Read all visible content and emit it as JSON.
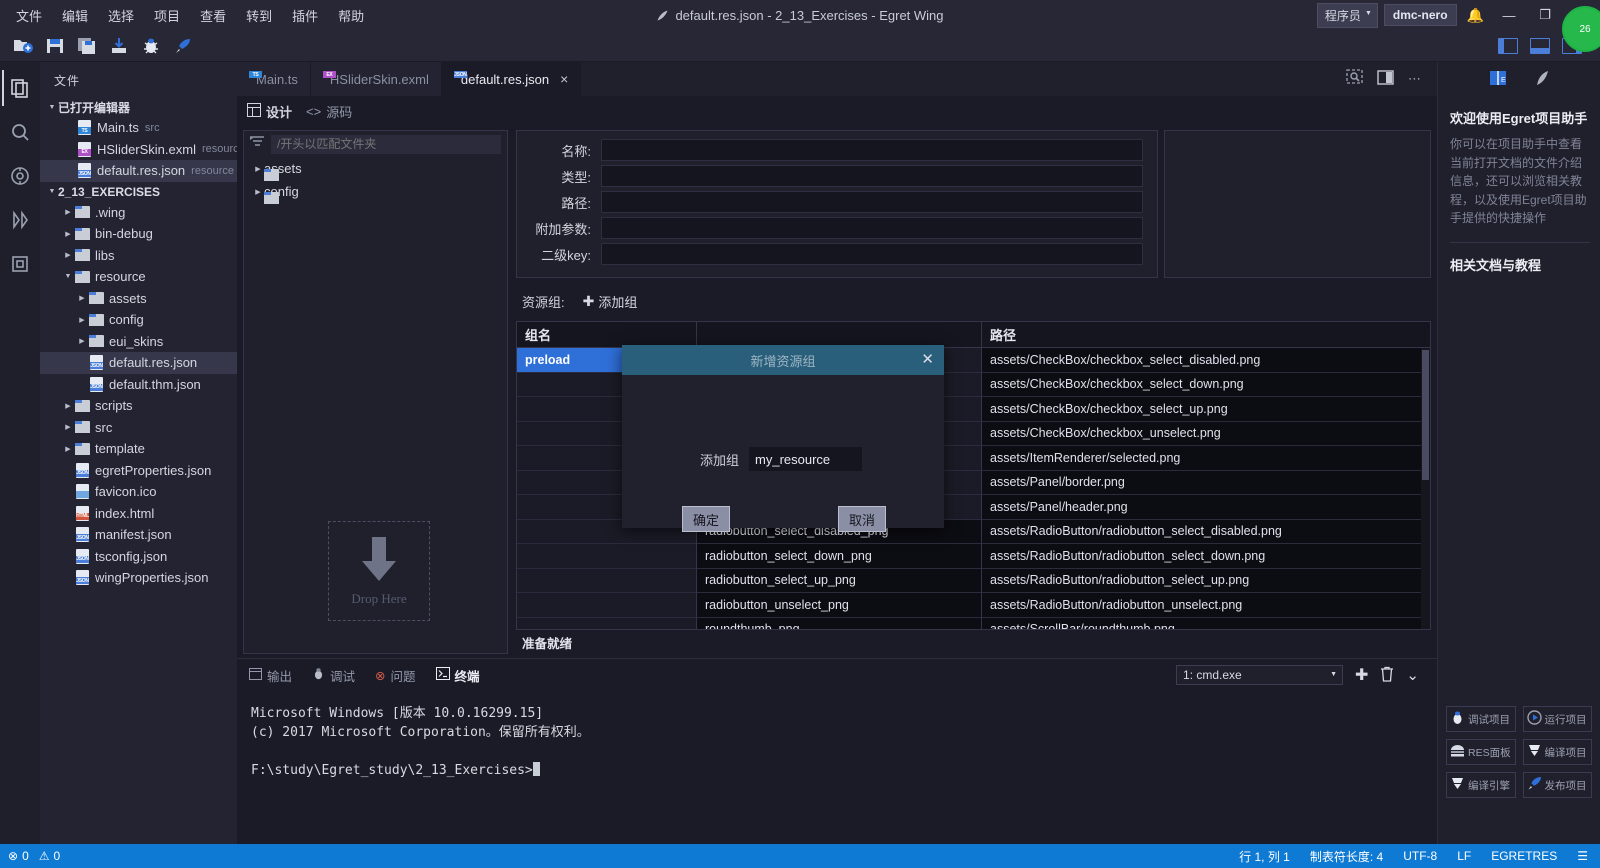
{
  "titlebar": {
    "menu": [
      "文件",
      "编辑",
      "选择",
      "项目",
      "查看",
      "转到",
      "插件",
      "帮助"
    ],
    "window_title": "default.res.json - 2_13_Exercises - Egret Wing",
    "role": "程序员",
    "user": "dmc-nero",
    "badge": "26"
  },
  "toolbar": {
    "icons": [
      "new-folder-icon",
      "save-icon",
      "save-all-icon",
      "import-icon",
      "debug-icon",
      "publish-icon"
    ],
    "layout_icons": [
      "layout-sidebar-icon",
      "layout-panel-icon",
      "layout-right-icon"
    ]
  },
  "activity": {
    "items": [
      "explorer-icon",
      "search-icon",
      "source-control-icon",
      "debug-icon",
      "extensions-icon"
    ]
  },
  "explorer": {
    "title": "文件",
    "open_editors_label": "已打开编辑器",
    "open_editors": [
      {
        "name": "Main.ts",
        "sub": "src",
        "icon": "ts-file-icon"
      },
      {
        "name": "HSliderSkin.exml",
        "sub": "resource\\eui_s...",
        "icon": "exml-file-icon"
      },
      {
        "name": "default.res.json",
        "sub": "resource",
        "icon": "json-file-icon"
      }
    ],
    "project_label": "2_13_EXERCISES",
    "tree": [
      {
        "name": ".wing",
        "type": "folder",
        "depth": 1,
        "open": false
      },
      {
        "name": "bin-debug",
        "type": "folder",
        "depth": 1,
        "open": false
      },
      {
        "name": "libs",
        "type": "folder",
        "depth": 1,
        "open": false
      },
      {
        "name": "resource",
        "type": "folder",
        "depth": 1,
        "open": true
      },
      {
        "name": "assets",
        "type": "folder",
        "depth": 2,
        "open": false
      },
      {
        "name": "config",
        "type": "folder",
        "depth": 2,
        "open": false
      },
      {
        "name": "eui_skins",
        "type": "folder",
        "depth": 2,
        "open": false
      },
      {
        "name": "default.res.json",
        "type": "json",
        "depth": 2,
        "selected": true
      },
      {
        "name": "default.thm.json",
        "type": "json",
        "depth": 2
      },
      {
        "name": "scripts",
        "type": "folder",
        "depth": 1,
        "open": false
      },
      {
        "name": "src",
        "type": "folder",
        "depth": 1,
        "open": false
      },
      {
        "name": "template",
        "type": "folder",
        "depth": 1,
        "open": false
      },
      {
        "name": "egretProperties.json",
        "type": "json",
        "depth": 1
      },
      {
        "name": "favicon.ico",
        "type": "ico",
        "depth": 1
      },
      {
        "name": "index.html",
        "type": "html",
        "depth": 1
      },
      {
        "name": "manifest.json",
        "type": "json",
        "depth": 1
      },
      {
        "name": "tsconfig.json",
        "type": "json",
        "depth": 1
      },
      {
        "name": "wingProperties.json",
        "type": "json",
        "depth": 1
      }
    ]
  },
  "editor": {
    "tabs": [
      {
        "label": "Main.ts",
        "icon": "ts-file-icon",
        "active": false
      },
      {
        "label": "HSliderSkin.exml",
        "icon": "exml-file-icon",
        "active": false
      },
      {
        "label": "default.res.json",
        "icon": "json-file-icon",
        "active": true,
        "close": "×"
      }
    ],
    "tab_tools": [
      "preview-icon",
      "split-editor-icon",
      "more-actions-icon"
    ],
    "subtabs": [
      {
        "label": "设计",
        "icon": "design-icon",
        "active": true
      },
      {
        "label": "源码",
        "icon": "code-icon",
        "active": false
      }
    ],
    "filter_placeholder": "/开头以匹配文件夹",
    "file_tree": [
      "assets",
      "config"
    ],
    "drop_here": "Drop Here",
    "form": {
      "fields": [
        {
          "label": "名称:",
          "value": ""
        },
        {
          "label": "类型:",
          "value": ""
        },
        {
          "label": "路径:",
          "value": ""
        },
        {
          "label": "附加参数:",
          "value": ""
        },
        {
          "label": "二级key:",
          "value": ""
        }
      ]
    },
    "group_label": "资源组:",
    "add_group": "添加组",
    "table": {
      "headers": [
        "组名",
        "",
        "路径"
      ],
      "group_names": [
        "preload"
      ],
      "rows": [
        {
          "key": "",
          "path": "assets/CheckBox/checkbox_select_disabled.png"
        },
        {
          "key": "",
          "path": "assets/CheckBox/checkbox_select_down.png"
        },
        {
          "key": "",
          "path": "assets/CheckBox/checkbox_select_up.png"
        },
        {
          "key": "",
          "path": "assets/CheckBox/checkbox_unselect.png"
        },
        {
          "key": "",
          "path": "assets/ItemRenderer/selected.png"
        },
        {
          "key": "",
          "path": "assets/Panel/border.png"
        },
        {
          "key": "",
          "path": "assets/Panel/header.png"
        },
        {
          "key": "radiobutton_select_disabled_png",
          "path": "assets/RadioButton/radiobutton_select_disabled.png"
        },
        {
          "key": "radiobutton_select_down_png",
          "path": "assets/RadioButton/radiobutton_select_down.png"
        },
        {
          "key": "radiobutton_select_up_png",
          "path": "assets/RadioButton/radiobutton_select_up.png"
        },
        {
          "key": "radiobutton_unselect_png",
          "path": "assets/RadioButton/radiobutton_unselect.png"
        },
        {
          "key": "roundthumb_png",
          "path": "assets/ScrollBar/roundthumb.png"
        }
      ]
    },
    "ready_status": "准备就绪"
  },
  "dialog": {
    "title": "新增资源组",
    "close": "✕",
    "field_label": "添加组",
    "field_value": "my_resource",
    "ok": "确定",
    "cancel": "取消"
  },
  "terminal": {
    "tabs": [
      {
        "label": "输出",
        "icon": "output-icon",
        "active": false
      },
      {
        "label": "调试",
        "icon": "debug-console-icon",
        "active": false
      },
      {
        "label": "问题",
        "icon": "problems-icon",
        "active": false
      },
      {
        "label": "终端",
        "icon": "terminal-icon",
        "active": true
      }
    ],
    "shell_select": "1: cmd.exe",
    "actions": [
      "add-terminal-icon",
      "kill-terminal-icon",
      "chevron-down-icon"
    ],
    "lines": [
      "Microsoft Windows [版本 10.0.16299.15]",
      "(c) 2017 Microsoft Corporation。保留所有权利。",
      "",
      "F:\\study\\Egret_study\\2_13_Exercises>"
    ]
  },
  "rightpanel": {
    "tabs": [
      "egret-assistant-icon",
      "wing-icon"
    ],
    "heading": "欢迎使用Egret项目助手",
    "paragraph": "你可以在项目助手中查看当前打开文档的文件介绍信息，还可以浏览相关教程，以及使用Egret项目助手提供的快捷操作",
    "docs_heading": "相关文档与教程",
    "buttons": [
      {
        "label": "调试项目",
        "icon": "debug-icon"
      },
      {
        "label": "运行项目",
        "icon": "run-icon"
      },
      {
        "label": "RES面板",
        "icon": "res-panel-icon"
      },
      {
        "label": "编译项目",
        "icon": "compile-icon"
      },
      {
        "label": "编译引擎",
        "icon": "compile-engine-icon"
      },
      {
        "label": "发布项目",
        "icon": "publish-icon"
      }
    ]
  },
  "statusbar": {
    "errors": "0",
    "warnings": "0",
    "cursor": "行 1, 列 1",
    "tabsize": "制表符长度: 4",
    "encoding": "UTF-8",
    "eol": "LF",
    "language": "EGRETRES",
    "feedback": "feedback-icon"
  }
}
